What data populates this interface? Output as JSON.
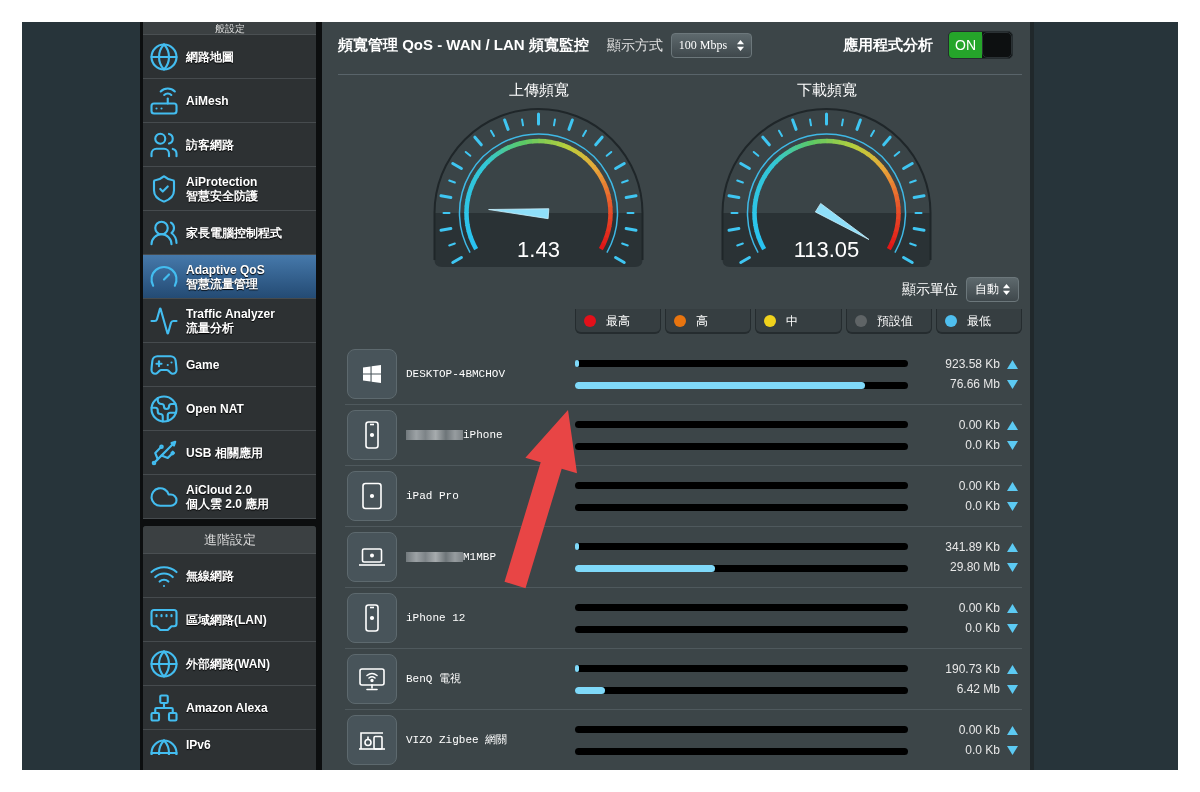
{
  "sidebar": {
    "sections": [
      {
        "header": "般設定",
        "items": [
          {
            "label": "網路地圖",
            "selected": false
          },
          {
            "label": "AiMesh",
            "selected": false
          },
          {
            "label": "訪客網路",
            "selected": false
          },
          {
            "label": "AiProtection",
            "sublabel": "智慧安全防護",
            "selected": false
          },
          {
            "label": "家長電腦控制程式",
            "selected": false
          },
          {
            "label": "Adaptive QoS",
            "sublabel": "智慧流量管理",
            "selected": true
          },
          {
            "label": "Traffic Analyzer",
            "sublabel": "流量分析",
            "selected": false
          },
          {
            "label": "Game",
            "selected": false
          },
          {
            "label": "Open NAT",
            "selected": false
          },
          {
            "label": "USB 相關應用",
            "selected": false
          },
          {
            "label": "AiCloud 2.0",
            "sublabel": "個人雲 2.0 應用",
            "selected": false
          }
        ]
      },
      {
        "header": "進階設定",
        "items": [
          {
            "label": "無線網路",
            "selected": false
          },
          {
            "label": "區域網路(LAN)",
            "selected": false
          },
          {
            "label": "外部網路(WAN)",
            "selected": false
          },
          {
            "label": "Amazon Alexa",
            "selected": false
          },
          {
            "label": "IPv6",
            "selected": false
          }
        ]
      }
    ]
  },
  "main": {
    "title": "頻寬管理 QoS - WAN / LAN 頻寬監控",
    "display_mode": {
      "label": "顯示方式",
      "value": "100 Mbps"
    },
    "app_analysis": {
      "label": "應用程式分析",
      "switch": {
        "text": "ON",
        "on": true
      }
    },
    "gauges": [
      {
        "label": "上傳頻寬",
        "value": "1.43"
      },
      {
        "label": "下載頻寬",
        "value": "113.05"
      }
    ],
    "display_unit": {
      "label": "顯示單位",
      "value": "自動"
    },
    "priority_legend": [
      {
        "label": "最高",
        "color": "#e3101a"
      },
      {
        "label": "高",
        "color": "#e8740f"
      },
      {
        "label": "中",
        "color": "#f0d21c"
      },
      {
        "label": "預設值",
        "color": "#5f6466"
      },
      {
        "label": "最低",
        "color": "#4fbfef"
      }
    ],
    "devices": [
      {
        "name": "DESKTOP-4BMCHOV",
        "blurred": false,
        "upload": {
          "reading": "923.58 Kb",
          "level": 0.012
        },
        "download": {
          "reading": "76.66 Mb",
          "level": 0.87
        }
      },
      {
        "name": "iPhone",
        "blurred": true,
        "upload": {
          "reading": "0.00 Kb"
        },
        "download": {
          "reading": "0.0 Kb"
        }
      },
      {
        "name": "iPad Pro",
        "blurred": false,
        "upload": {
          "reading": "0.00 Kb"
        },
        "download": {
          "reading": "0.0 Kb"
        }
      },
      {
        "name": "M1MBP",
        "blurred": true,
        "upload": {
          "reading": "341.89 Kb",
          "level": 0.012
        },
        "download": {
          "reading": "29.80 Mb",
          "level": 0.42
        }
      },
      {
        "name": "iPhone 12",
        "blurred": false,
        "upload": {
          "reading": "0.00 Kb"
        },
        "download": {
          "reading": "0.0 Kb"
        }
      },
      {
        "name": "BenQ 電視",
        "blurred": false,
        "upload": {
          "reading": "190.73 Kb",
          "level": 0.012
        },
        "download": {
          "reading": "6.42 Mb",
          "level": 0.09
        }
      },
      {
        "name": "VIZO Zigbee 網關",
        "blurred": false,
        "upload": {
          "reading": "0.00 Kb"
        },
        "download": {
          "reading": "0.0 Kb"
        }
      }
    ]
  }
}
